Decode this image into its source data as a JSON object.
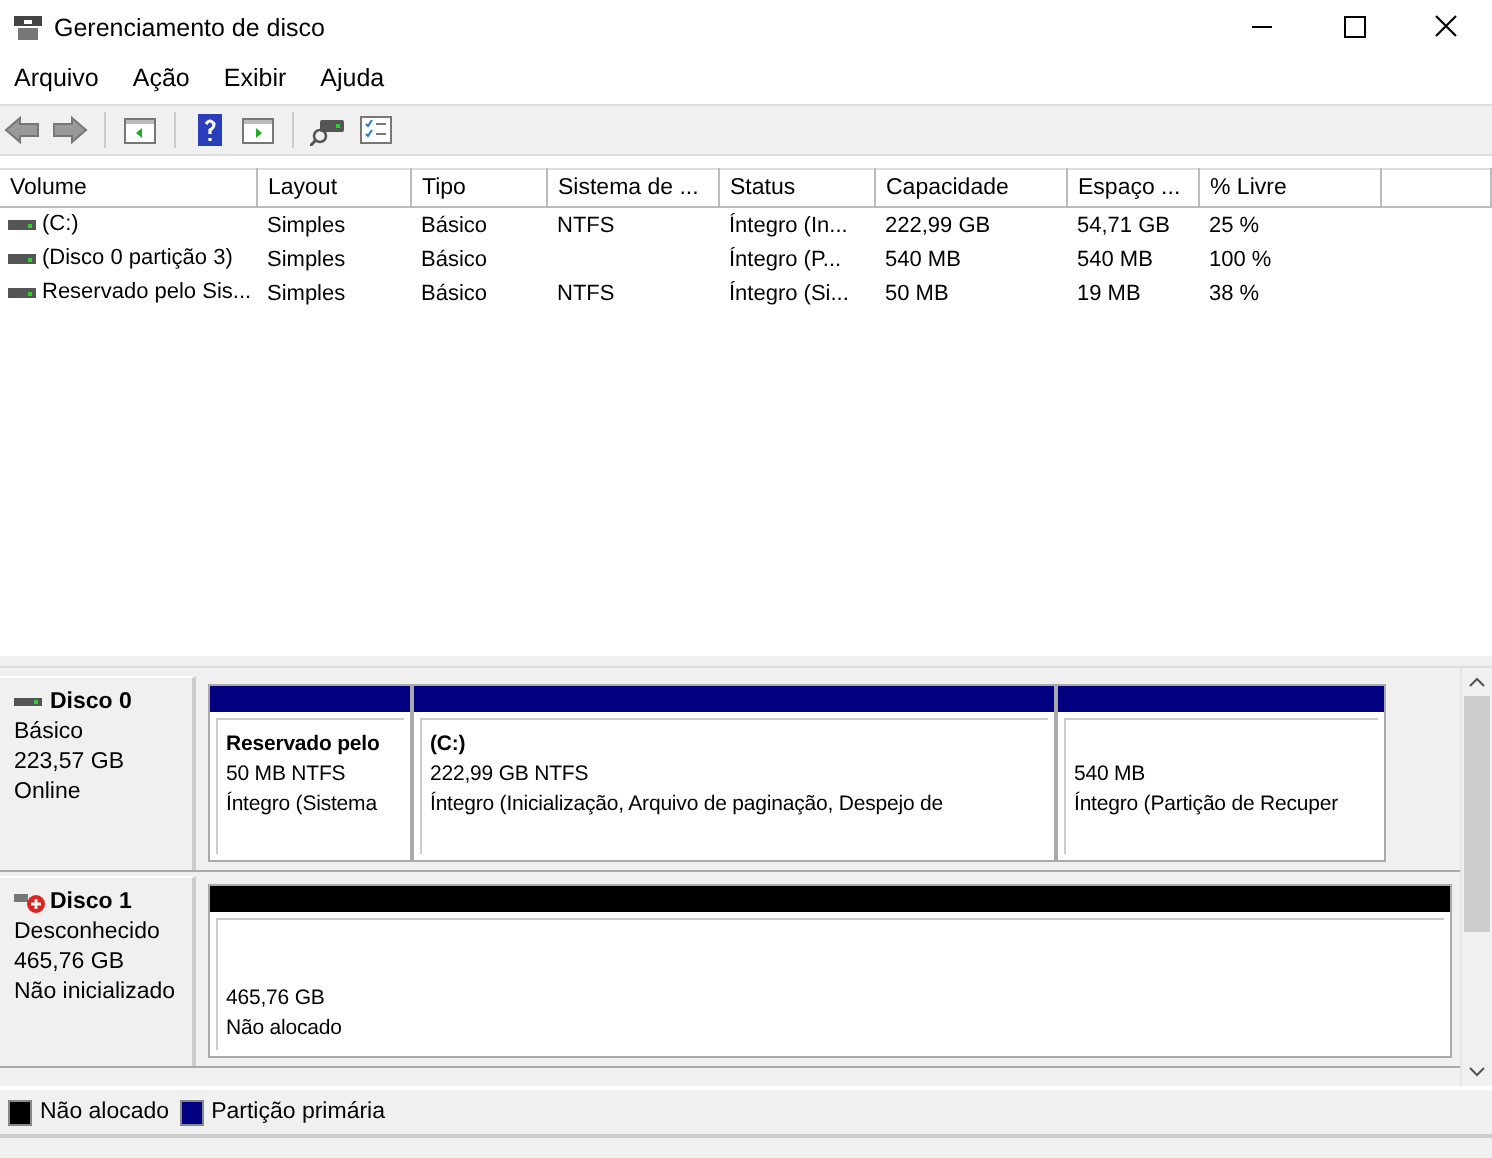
{
  "window": {
    "title": "Gerenciamento de disco"
  },
  "menu": [
    "Arquivo",
    "Ação",
    "Exibir",
    "Ajuda"
  ],
  "table": {
    "columns": [
      "Volume",
      "Layout",
      "Tipo",
      "Sistema de ...",
      "Status",
      "Capacidade",
      "Espaço ...",
      "% Livre"
    ],
    "rows": [
      {
        "cells": [
          " (C:)",
          "Simples",
          "Básico",
          "NTFS",
          "Íntegro (In...",
          "222,99 GB",
          "54,71 GB",
          "25 %"
        ]
      },
      {
        "cells": [
          "(Disco 0 partição 3)",
          "Simples",
          "Básico",
          "",
          "Íntegro (P...",
          "540 MB",
          "540 MB",
          "100 %"
        ]
      },
      {
        "cells": [
          "Reservado pelo Sis...",
          "Simples",
          "Básico",
          "NTFS",
          "Íntegro (Si...",
          "50 MB",
          "19 MB",
          "38 %"
        ]
      }
    ]
  },
  "disks": [
    {
      "name": "Disco 0",
      "error": false,
      "lines": [
        "Básico",
        "223,57 GB",
        "Online"
      ],
      "partitions": [
        {
          "kind": "primary",
          "title": "Reservado pelo",
          "lines": [
            "50 MB NTFS",
            "Íntegro (Sistema"
          ]
        },
        {
          "kind": "primary",
          "title": " (C:)",
          "lines": [
            "222,99 GB NTFS",
            "Íntegro (Inicialização, Arquivo de paginação, Despejo de"
          ]
        },
        {
          "kind": "primary",
          "lines": [
            "540 MB",
            "Íntegro (Partição de Recuper"
          ]
        }
      ]
    },
    {
      "name": "Disco 1",
      "error": true,
      "lines": [
        "Desconhecido",
        "465,76 GB",
        "Não inicializado"
      ],
      "partitions": [
        {
          "kind": "unallocated",
          "lines": [
            "465,76 GB",
            "Não alocado"
          ]
        }
      ]
    }
  ],
  "legend": [
    {
      "label": "Não alocado",
      "color": "#000000"
    },
    {
      "label": "Partição primária",
      "color": "#000080"
    }
  ]
}
